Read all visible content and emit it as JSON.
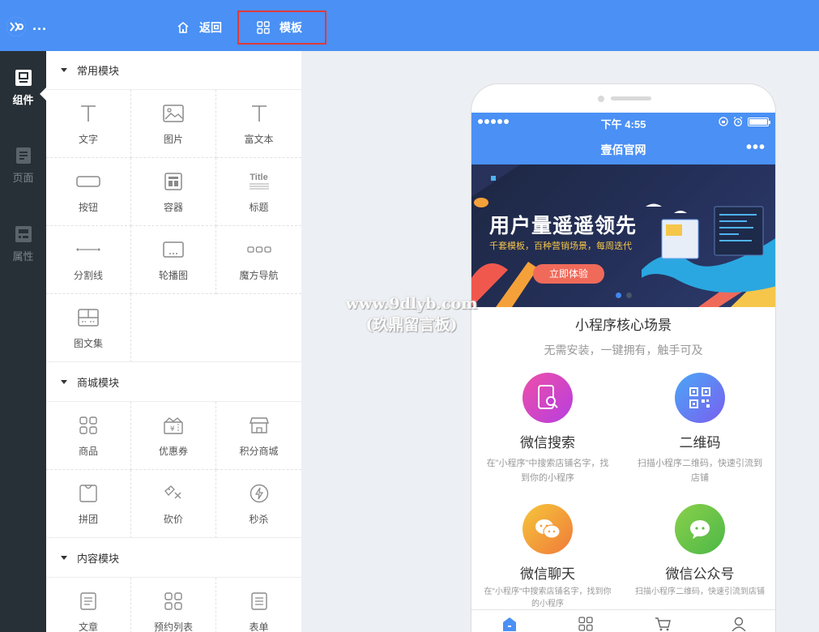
{
  "topbar": {
    "logo_dots": "...",
    "back_label": "返回",
    "template_label": "模板",
    "bg_color": "#4a90f5"
  },
  "rail": {
    "items": [
      {
        "label": "组件",
        "icon": "component-icon",
        "active": true
      },
      {
        "label": "页面",
        "icon": "page-icon",
        "active": false
      },
      {
        "label": "属性",
        "icon": "property-icon",
        "active": false
      }
    ]
  },
  "panel": {
    "sections": [
      {
        "title": "常用模块",
        "items": [
          {
            "label": "文字",
            "icon": "text-icon"
          },
          {
            "label": "图片",
            "icon": "image-icon"
          },
          {
            "label": "富文本",
            "icon": "richtext-icon"
          },
          {
            "label": "按钮",
            "icon": "button-icon"
          },
          {
            "label": "容器",
            "icon": "container-icon"
          },
          {
            "label": "标题",
            "icon": "title-icon",
            "icon_text": "Title"
          },
          {
            "label": "分割线",
            "icon": "divider-icon"
          },
          {
            "label": "轮播图",
            "icon": "carousel-icon"
          },
          {
            "label": "魔方导航",
            "icon": "cube-nav-icon"
          },
          {
            "label": "图文集",
            "icon": "gallery-icon"
          }
        ]
      },
      {
        "title": "商城模块",
        "items": [
          {
            "label": "商品",
            "icon": "product-icon"
          },
          {
            "label": "优惠券",
            "icon": "coupon-icon"
          },
          {
            "label": "积分商城",
            "icon": "points-mall-icon"
          },
          {
            "label": "拼团",
            "icon": "group-buy-icon"
          },
          {
            "label": "砍价",
            "icon": "bargain-icon"
          },
          {
            "label": "秒杀",
            "icon": "flash-sale-icon"
          }
        ]
      },
      {
        "title": "内容模块",
        "items": [
          {
            "label": "文章",
            "icon": "article-icon"
          },
          {
            "label": "预约列表",
            "icon": "booking-list-icon"
          },
          {
            "label": "表单",
            "icon": "form-icon"
          }
        ]
      }
    ]
  },
  "phone": {
    "time": "下午 4:55",
    "title": "壹佰官网",
    "more": "•••",
    "banner": {
      "title": "用户量遥遥领先",
      "subtitle": "千套模板，百种营销场景，每周迭代",
      "button": "立即体验"
    },
    "core_title": "小程序核心场景",
    "core_subtitle": "无需安装，一键拥有，触手可及",
    "features": [
      {
        "name": "微信搜索",
        "desc": "在\"小程序\"中搜索店铺名字，找到你的小程序",
        "icon": "search-phone-icon",
        "color": "#d648c9"
      },
      {
        "name": "二维码",
        "desc": "扫描小程序二维码，快速引流到店铺",
        "icon": "qrcode-icon",
        "color": "#4a7cf0"
      },
      {
        "name": "微信聊天",
        "desc": "在\"小程序\"中搜索店铺名字，找到你的小程序",
        "icon": "chat-icon",
        "color": "#f5a13a"
      },
      {
        "name": "微信公众号",
        "desc": "扫描小程序二维码，快速引流到店铺",
        "icon": "official-account-icon",
        "color": "#6cc644"
      }
    ]
  },
  "watermark": {
    "line1": "www.9dlyb.com",
    "line2": "(玖鼎留言板)"
  }
}
